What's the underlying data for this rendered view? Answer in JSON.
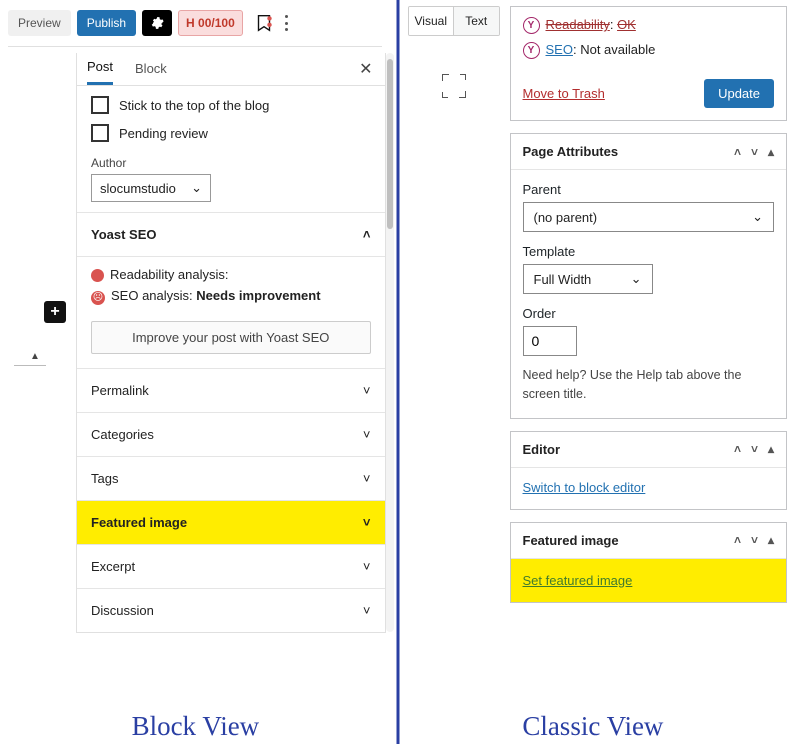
{
  "block": {
    "toolbar": {
      "preview": "Preview",
      "publish": "Publish",
      "h_score": "H 00/100"
    },
    "tabs": {
      "post": "Post",
      "block": "Block"
    },
    "options": {
      "sticky": "Stick to the top of the blog",
      "pending": "Pending review",
      "author_label": "Author",
      "author_value": "slocumstudio"
    },
    "yoast": {
      "title": "Yoast SEO",
      "readability": "Readability analysis:",
      "seo_label": "SEO analysis:",
      "seo_value": "Needs improvement",
      "improve_btn": "Improve your post with Yoast SEO"
    },
    "panels": {
      "permalink": "Permalink",
      "categories": "Categories",
      "tags": "Tags",
      "featured": "Featured image",
      "excerpt": "Excerpt",
      "discussion": "Discussion"
    }
  },
  "classic": {
    "vt": {
      "visual": "Visual",
      "text": "Text"
    },
    "yoast": {
      "readability_label": "Readability",
      "readability_val": "OK",
      "seo_label": "SEO",
      "seo_val": "Not available"
    },
    "trash": "Move to Trash",
    "update": "Update",
    "page_attr": {
      "title": "Page Attributes",
      "parent_label": "Parent",
      "parent_val": "(no parent)",
      "template_label": "Template",
      "template_val": "Full Width",
      "order_label": "Order",
      "order_val": "0",
      "help": "Need help? Use the Help tab above the screen title."
    },
    "editor": {
      "title": "Editor",
      "switch": "Switch to block editor"
    },
    "featured": {
      "title": "Featured image",
      "link": "Set featured image"
    }
  },
  "captions": {
    "left": "Block View",
    "right": "Classic View"
  }
}
